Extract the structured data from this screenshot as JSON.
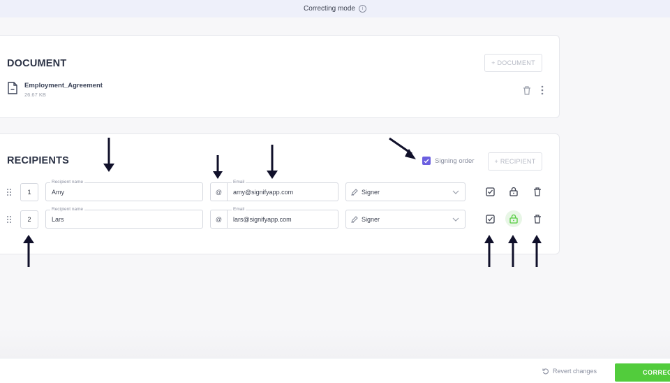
{
  "topbar": {
    "mode_label": "Correcting mode"
  },
  "document_section": {
    "title": "DOCUMENT",
    "add_button": "+ DOCUMENT",
    "file": {
      "name": "Employment_Agreement",
      "size": "26.67 KB"
    }
  },
  "recipients_section": {
    "title": "RECIPIENTS",
    "signing_order_label": "Signing order",
    "signing_order_checked": true,
    "add_button": "+ RECIPIENT",
    "name_label": "Recipient name",
    "email_label": "Email",
    "email_prefix": "@",
    "rows": [
      {
        "order": "1",
        "name": "Amy",
        "email": "amy@signifyapp.com",
        "role": "Signer",
        "locked": true
      },
      {
        "order": "2",
        "name": "Lars",
        "email": "lars@signifyapp.com",
        "role": "Signer",
        "locked": false
      }
    ]
  },
  "footer": {
    "revert_label": "Revert changes",
    "submit_label": "CORRECT"
  },
  "colors": {
    "accent": "#6b5fe0",
    "success": "#52cc3c",
    "arrow": "#10102a"
  },
  "icons": [
    "info-icon",
    "file-icon",
    "trash-icon",
    "more-vertical-icon",
    "drag-handle-icon",
    "pen-icon",
    "chevron-down-icon",
    "checkbox-icon",
    "lock-icon",
    "unlock-icon",
    "revert-icon",
    "check-icon"
  ]
}
